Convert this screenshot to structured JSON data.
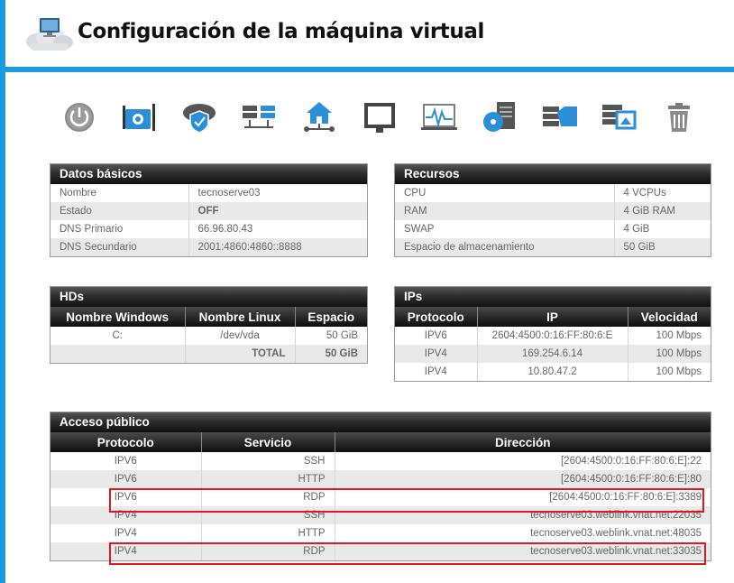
{
  "page": {
    "title": "Configuración de la máquina virtual"
  },
  "toolbar": {
    "icons": [
      "power-icon",
      "maintenance-icon",
      "cloud-security-icon",
      "servers-icon",
      "home-network-icon",
      "console-monitor-icon",
      "monitoring-icon",
      "backup-disk-icon",
      "file-transfer-icon",
      "server-snapshot-icon",
      "trash-icon"
    ]
  },
  "datos_basicos": {
    "title": "Datos básicos",
    "rows": [
      {
        "label": "Nombre",
        "value": "tecnoserve03"
      },
      {
        "label": "Estado",
        "value": "OFF"
      },
      {
        "label": "DNS Primario",
        "value": "66.96.80.43"
      },
      {
        "label": "DNS Secundario",
        "value": "2001:4860:4860::8888"
      }
    ]
  },
  "recursos": {
    "title": "Recursos",
    "rows": [
      {
        "label": "CPU",
        "value": "4 VCPUs"
      },
      {
        "label": "RAM",
        "value": "4 GiB RAM"
      },
      {
        "label": "SWAP",
        "value": "4 GiB"
      },
      {
        "label": "Espacio de almacenamiento",
        "value": "50 GiB"
      }
    ]
  },
  "hds": {
    "title": "HDs",
    "headers": [
      "Nombre Windows",
      "Nombre Linux",
      "Espacio"
    ],
    "rows": [
      [
        "C:",
        "/dev/vda",
        "50 GiB"
      ]
    ],
    "total_label": "TOTAL",
    "total_value": "50 GiB"
  },
  "ips": {
    "title": "IPs",
    "headers": [
      "Protocolo",
      "IP",
      "Velocidad"
    ],
    "rows": [
      [
        "IPV6",
        "2604:4500:0:16:FF:80:6:E",
        "100 Mbps"
      ],
      [
        "IPV4",
        "169.254.6.14",
        "100 Mbps"
      ],
      [
        "IPV4",
        "10.80.47.2",
        "100 Mbps"
      ]
    ]
  },
  "acceso": {
    "title": "Acceso público",
    "headers": [
      "Protocolo",
      "Servicio",
      "Dirección"
    ],
    "rows": [
      [
        "IPV6",
        "SSH",
        "[2604:4500:0:16:FF:80:6:E]:22"
      ],
      [
        "IPV6",
        "HTTP",
        "[2604:4500:0:16:FF:80:6:E]:80"
      ],
      [
        "IPV6",
        "RDP",
        "[2604:4500:0:16:FF:80:6:E]:3389"
      ],
      [
        "IPV4",
        "SSH",
        "tecnoserve03.weblink.vnat.net:22035"
      ],
      [
        "IPV4",
        "HTTP",
        "tecnoserve03.weblink.vnat.net:48035"
      ],
      [
        "IPV4",
        "RDP",
        "tecnoserve03.weblink.vnat.net:33035"
      ]
    ]
  },
  "colors": {
    "accent": "#1a9be0",
    "highlight": "#e0191f"
  }
}
